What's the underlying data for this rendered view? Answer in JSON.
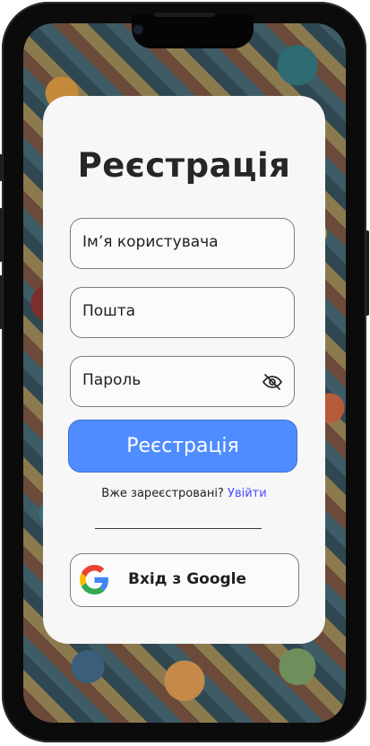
{
  "register": {
    "title": "Реєстрація",
    "username_placeholder": "Ім’я користувача",
    "email_placeholder": "Пошта",
    "password_placeholder": "Пароль",
    "submit_label": "Реєстрація",
    "already_registered": "Вже зареєстровані?",
    "login_link": "Увійти",
    "google_label": "Вхід з Google"
  },
  "icons": {
    "password_toggle": "eye-off-icon",
    "google": "google-logo-icon"
  },
  "colors": {
    "accent": "#4f8cff",
    "link": "#4a4aff",
    "card_background": "#f7f7f8"
  }
}
